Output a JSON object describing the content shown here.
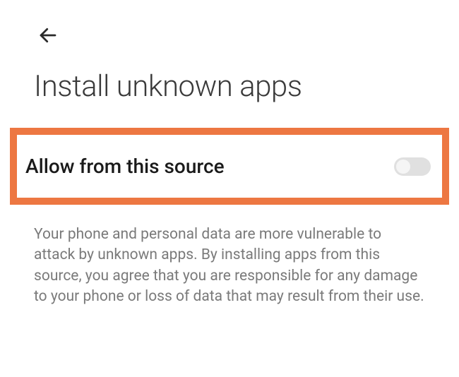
{
  "header": {
    "back_icon": "back"
  },
  "page": {
    "title": "Install unknown apps"
  },
  "setting": {
    "label": "Allow from this source",
    "toggle_state": "off"
  },
  "description": {
    "text": "Your phone and personal data are more vulnerable to attack by unknown apps. By installing apps from this source, you agree that you are responsible for any damage to your phone or loss of data that may result from their use."
  }
}
